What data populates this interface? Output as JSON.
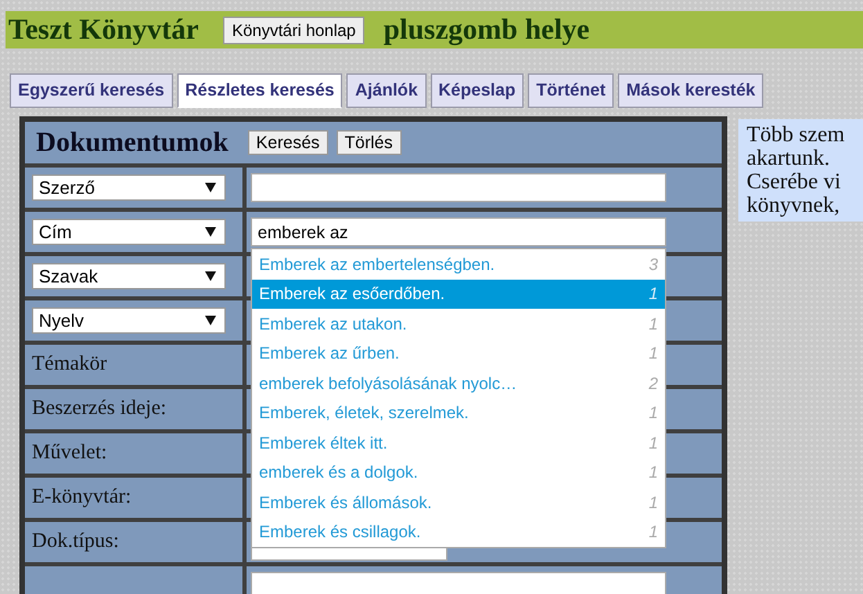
{
  "header": {
    "title": "Teszt Könyvtár",
    "button": "Könyvtári honlap",
    "placeholder_text": "pluszgomb helye"
  },
  "tabs": [
    {
      "label": "Egyszerű keresés",
      "selected": false
    },
    {
      "label": "Részletes keresés",
      "selected": true
    },
    {
      "label": "Ajánlók",
      "selected": false
    },
    {
      "label": "Képeslap",
      "selected": false
    },
    {
      "label": "Történet",
      "selected": false
    },
    {
      "label": "Mások keresték",
      "selected": false
    }
  ],
  "panel": {
    "title": "Dokumentumok",
    "buttons": [
      "Keresés",
      "Törlés"
    ],
    "rows": [
      {
        "kind": "select",
        "label": "Szerző",
        "field": {
          "kind": "input"
        }
      },
      {
        "kind": "select",
        "label": "Cím",
        "field": {
          "kind": "input",
          "value": "emberek az",
          "suggestions": [
            {
              "text": "Emberek az embertelenségben.",
              "count": "3",
              "selected": false
            },
            {
              "text": "Emberek az esőerdőben.",
              "count": "1",
              "selected": true
            },
            {
              "text": "Emberek az utakon.",
              "count": "1",
              "selected": false
            },
            {
              "text": "Emberek az űrben.",
              "count": "1",
              "selected": false
            },
            {
              "text": "emberek befolyásolásának nyolc…",
              "count": "2",
              "selected": false
            },
            {
              "text": "Emberek, életek, szerelmek.",
              "count": "1",
              "selected": false
            },
            {
              "text": "Emberek éltek itt.",
              "count": "1",
              "selected": false
            },
            {
              "text": "emberek és a dolgok.",
              "count": "1",
              "selected": false
            },
            {
              "text": "Emberek és állomások.",
              "count": "1",
              "selected": false
            },
            {
              "text": "Emberek és csillagok.",
              "count": "1",
              "selected": false
            }
          ]
        }
      },
      {
        "kind": "select",
        "label": "Szavak"
      },
      {
        "kind": "select",
        "label": "Nyelv"
      },
      {
        "kind": "label",
        "label": "Témakör"
      },
      {
        "kind": "label",
        "label": "Beszerzés ideje:"
      },
      {
        "kind": "label",
        "label": "Művelet:"
      },
      {
        "kind": "label",
        "label": "E-könyvtár:"
      },
      {
        "kind": "label",
        "label": "Dok.típus:",
        "field": {
          "kind": "select"
        }
      },
      {
        "kind": "label",
        "field": {
          "kind": "input"
        }
      }
    ]
  },
  "note": {
    "lines": [
      "Több szem",
      "akartunk.",
      "Cserébe vi",
      "könyvnek,"
    ]
  }
}
